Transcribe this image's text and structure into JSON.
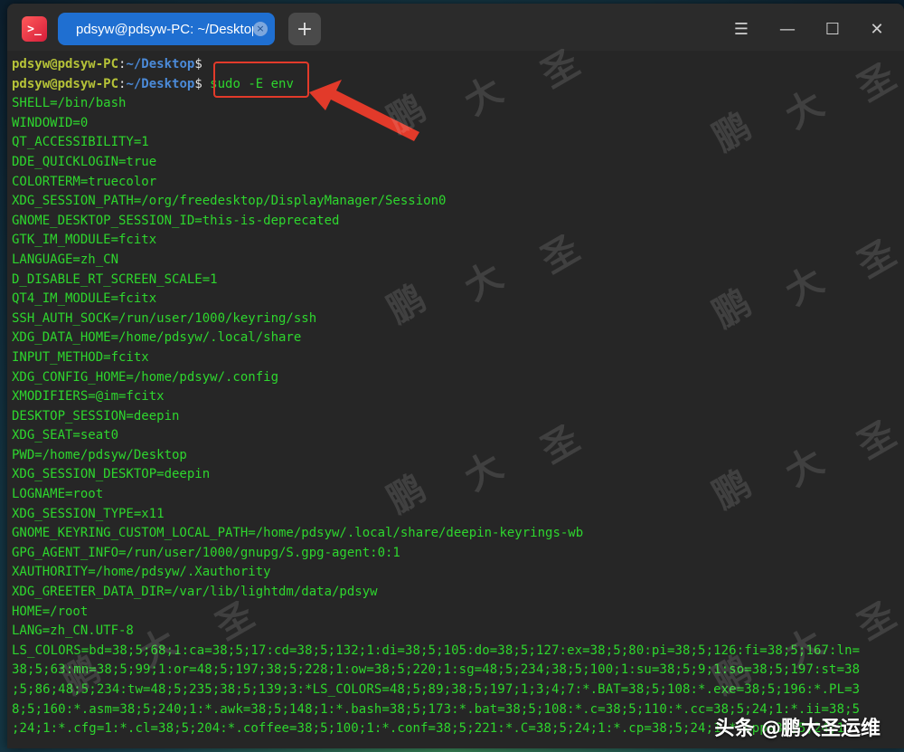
{
  "window": {
    "tab_title": "pdsyw@pdsyw-PC: ~/Desktop",
    "tab_close_icon": "×",
    "new_tab_icon": "+",
    "menu_icon": "☰",
    "minimize_icon": "—",
    "maximize_icon": "☐",
    "close_icon": "✕",
    "app_icon": ">_"
  },
  "prompt": {
    "user_host": "pdsyw@pdsyw-PC",
    "sep": ":",
    "path": "~/Desktop",
    "symbol": "$",
    "command": " sudo -E env"
  },
  "env_lines": [
    "SHELL=/bin/bash",
    "WINDOWID=0",
    "QT_ACCESSIBILITY=1",
    "DDE_QUICKLOGIN=true",
    "COLORTERM=truecolor",
    "XDG_SESSION_PATH=/org/freedesktop/DisplayManager/Session0",
    "GNOME_DESKTOP_SESSION_ID=this-is-deprecated",
    "GTK_IM_MODULE=fcitx",
    "LANGUAGE=zh_CN",
    "D_DISABLE_RT_SCREEN_SCALE=1",
    "QT4_IM_MODULE=fcitx",
    "SSH_AUTH_SOCK=/run/user/1000/keyring/ssh",
    "XDG_DATA_HOME=/home/pdsyw/.local/share",
    "INPUT_METHOD=fcitx",
    "XDG_CONFIG_HOME=/home/pdsyw/.config",
    "XMODIFIERS=@im=fcitx",
    "DESKTOP_SESSION=deepin",
    "XDG_SEAT=seat0",
    "PWD=/home/pdsyw/Desktop",
    "XDG_SESSION_DESKTOP=deepin",
    "LOGNAME=root",
    "XDG_SESSION_TYPE=x11",
    "GNOME_KEYRING_CUSTOM_LOCAL_PATH=/home/pdsyw/.local/share/deepin-keyrings-wb",
    "GPG_AGENT_INFO=/run/user/1000/gnupg/S.gpg-agent:0:1",
    "XAUTHORITY=/home/pdsyw/.Xauthority",
    "XDG_GREETER_DATA_DIR=/var/lib/lightdm/data/pdsyw",
    "HOME=/root",
    "LANG=zh_CN.UTF-8"
  ],
  "ls_colors_lines": [
    "LS_COLORS=bd=38;5;68;1:ca=38;5;17:cd=38;5;132;1:di=38;5;105:do=38;5;127:ex=38;5;80:pi=38;5;126:fi=38;5;167:ln=",
    "38;5;63:mn=38;5;99;1:or=48;5;197;38;5;228;1:ow=38;5;220;1:sg=48;5;234;38;5;100;1:su=38;5;9;1:so=38;5;197:st=38",
    ";5;86;48;5;234:tw=48;5;235;38;5;139;3:*LS_COLORS=48;5;89;38;5;197;1;3;4;7:*.BAT=38;5;108:*.exe=38;5;196:*.PL=3",
    "8;5;160:*.asm=38;5;240;1:*.awk=38;5;148;1:*.bash=38;5;173:*.bat=38;5;108:*.c=38;5;110:*.cc=38;5;24;1:*.ii=38;5",
    ";24;1:*.cfg=1:*.cl=38;5;204:*.coffee=38;5;100;1:*.conf=38;5;221:*.C=38;5;24;1:*.cp=38;5;24;1:*.cpp=38;5;24;1"
  ],
  "watermark": {
    "c1": "鹏",
    "c2": "大",
    "c3": "圣"
  },
  "brand": "头条 @鹏大圣运维",
  "colors": {
    "terminal_bg": "#262626",
    "text_green": "#2ed62e",
    "prompt_user": "#b6c338",
    "prompt_path": "#4b8ad8",
    "tab_active": "#1f6fd1",
    "annotation_red": "#e23a2a"
  }
}
